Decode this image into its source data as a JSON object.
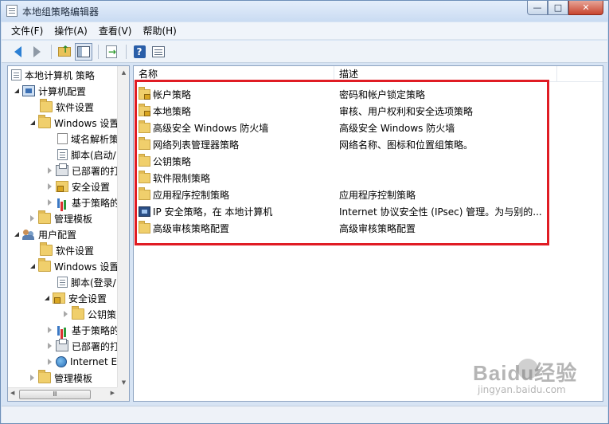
{
  "window": {
    "title": "本地组策略编辑器",
    "controls": {
      "minimize": "—",
      "maximize": "□",
      "close": "✕"
    }
  },
  "menu": [
    {
      "label": "文件(F)"
    },
    {
      "label": "操作(A)"
    },
    {
      "label": "查看(V)"
    },
    {
      "label": "帮助(H)"
    }
  ],
  "toolbar": {
    "icons": [
      "back-arrow-icon",
      "forward-arrow-icon",
      "up-folder-icon",
      "show-hide-tree-icon",
      "export-list-icon",
      "help-icon",
      "properties-icon"
    ]
  },
  "tree": {
    "root": "本地计算机 策略",
    "items": [
      {
        "label": "计算机配置",
        "icon": "computer-icon"
      },
      {
        "label": "软件设置",
        "icon": "folder-icon"
      },
      {
        "label": "Windows 设置",
        "icon": "folder-icon"
      },
      {
        "label": "域名解析策",
        "icon": "document-icon"
      },
      {
        "label": "脚本(启动/",
        "icon": "script-icon"
      },
      {
        "label": "已部署的打",
        "icon": "printer-icon"
      },
      {
        "label": "安全设置",
        "icon": "security-folder-icon"
      },
      {
        "label": "基于策略的",
        "icon": "qos-chart-icon"
      },
      {
        "label": "管理模板",
        "icon": "folder-icon"
      },
      {
        "label": "用户配置",
        "icon": "users-icon"
      },
      {
        "label": "软件设置",
        "icon": "folder-icon"
      },
      {
        "label": "Windows 设置",
        "icon": "folder-icon"
      },
      {
        "label": "脚本(登录/",
        "icon": "script-icon"
      },
      {
        "label": "安全设置",
        "icon": "security-folder-icon"
      },
      {
        "label": "公钥策",
        "icon": "folder-icon"
      },
      {
        "label": "基于策略的",
        "icon": "qos-chart-icon"
      },
      {
        "label": "已部署的打",
        "icon": "printer-icon"
      },
      {
        "label": "Internet E",
        "icon": "globe-icon"
      },
      {
        "label": "管理模板",
        "icon": "folder-icon"
      }
    ],
    "hscroll_grip": "Ⅲ"
  },
  "list": {
    "columns": {
      "name": "名称",
      "description": "描述"
    },
    "rows": [
      {
        "name": "帐户策略",
        "description": "密码和帐户锁定策略",
        "icon": "locked-folder-icon"
      },
      {
        "name": "本地策略",
        "description": "审核、用户权利和安全选项策略",
        "icon": "locked-folder-icon"
      },
      {
        "name": "高级安全 Windows 防火墙",
        "description": "高级安全 Windows 防火墙",
        "icon": "folder-icon"
      },
      {
        "name": "网络列表管理器策略",
        "description": "网络名称、图标和位置组策略。",
        "icon": "folder-icon"
      },
      {
        "name": "公钥策略",
        "description": "",
        "icon": "folder-icon"
      },
      {
        "name": "软件限制策略",
        "description": "",
        "icon": "folder-icon"
      },
      {
        "name": "应用程序控制策略",
        "description": "应用程序控制策略",
        "icon": "folder-icon"
      },
      {
        "name": "IP 安全策略，在 本地计算机",
        "description": "Internet 协议安全性 (IPsec) 管理。为与别的...",
        "icon": "ipsec-policy-icon"
      },
      {
        "name": "高级审核策略配置",
        "description": "高级审核策略配置",
        "icon": "folder-icon"
      }
    ]
  },
  "annotation": {
    "color": "#e01c24"
  },
  "watermark": {
    "main": "Baidu经验",
    "sub": "jingyan.baidu.com"
  }
}
